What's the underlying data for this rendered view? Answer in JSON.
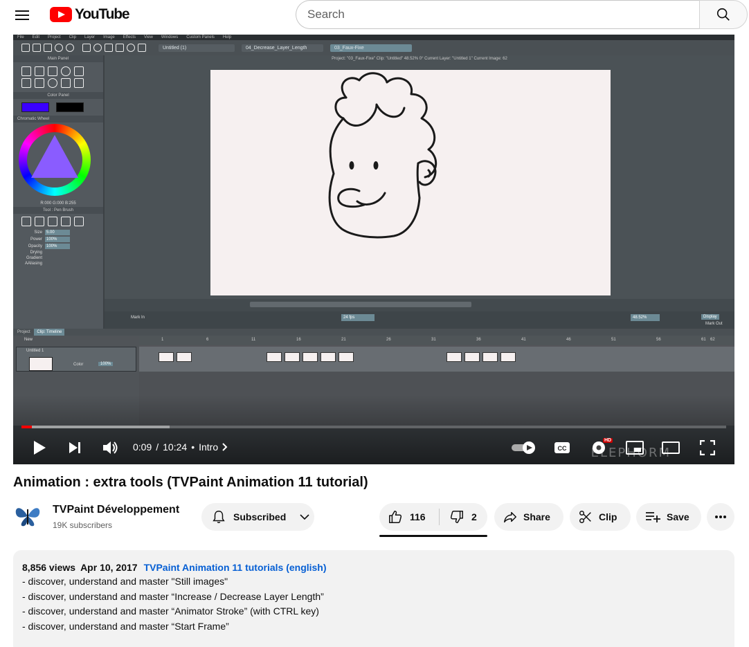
{
  "masthead": {
    "logo_text": "YouTube",
    "search_placeholder": "Search"
  },
  "app": {
    "menu": [
      "File",
      "Edit",
      "Project",
      "Clip",
      "Layer",
      "Image",
      "Effects",
      "View",
      "Windows",
      "Custom Panels",
      "Help"
    ],
    "doc_tabs": [
      "Untitled (1)",
      "04_Decrease_Layer_Length",
      "03_Faux-Fixe"
    ],
    "canvas_info": "Project: \"03_Faux-Fixe\"  Clip: \"Untitled\"  48.52%  0°  Current Layer: \"Untitled 1\"  Current Image: 62",
    "main_panel": "Main Panel",
    "color_panel": "Color Panel",
    "chromatic_wheel": "Chromatic Wheel",
    "rgb_readout": "R:000 G:000 B:255",
    "tool_panel": "Tool : Pen Brush",
    "options": [
      {
        "label": "Size",
        "value": "5.00"
      },
      {
        "label": "Power",
        "value": "100%"
      },
      {
        "label": "Opacity",
        "value": "100%"
      }
    ],
    "option_labels": [
      "Drying",
      "Gradient",
      "AAliasing"
    ],
    "fps": "24 fps",
    "zoom": "48.52%",
    "mark_in": "Mark In",
    "mark_out": "Mark Out",
    "display": "Display",
    "timeline_tab_project": "Project",
    "timeline_tab_clip": "Clip: Timeline",
    "layer_name": "Untitled 1",
    "layer_new": "New",
    "layer_color": "Color",
    "layer_opacity": "100%",
    "ruler_ticks": [
      "1",
      "6",
      "11",
      "16",
      "21",
      "26",
      "31",
      "36",
      "41",
      "46",
      "51",
      "56",
      "61",
      "62"
    ]
  },
  "player": {
    "played_fraction": 0.0146,
    "buffered_fraction": 0.21,
    "time_current": "0:09",
    "time_separator": "/",
    "time_total": "10:24",
    "chapter_bullet": "•",
    "chapter": "Intro",
    "watermark": "ELEPHORM",
    "hd_badge": "HD"
  },
  "video": {
    "title": "Animation : extra tools (TVPaint Animation 11 tutorial)",
    "channel": "TVPaint Développement",
    "subscribers": "19K subscribers",
    "subscribed_label": "Subscribed",
    "likes": "116",
    "dislikes": "2",
    "share_label": "Share",
    "clip_label": "Clip",
    "save_label": "Save"
  },
  "description": {
    "views": "8,856 views",
    "date": "Apr 10, 2017",
    "playlist_link": "TVPaint Animation 11 tutorials (english)",
    "lines": [
      "- discover, understand and master \"Still images\"",
      "- discover, understand and master “Increase / Decrease Layer Length”",
      "- discover, understand and master “Animator Stroke” (with CTRL key)",
      "- discover, understand and master “Start Frame”"
    ]
  },
  "colors": {
    "brand_red": "#ff0000",
    "link_blue": "#065fd4",
    "app_accent": "#6c8a95",
    "primary_color_swatch": "#3a00ff",
    "secondary_color_swatch": "#000000"
  }
}
